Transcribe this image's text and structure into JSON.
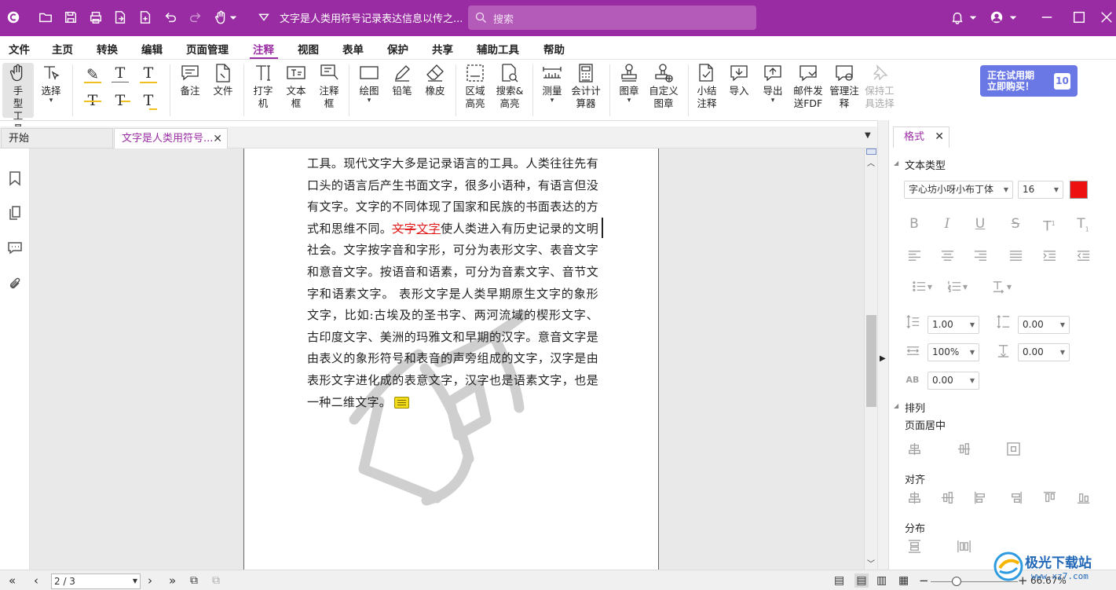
{
  "titlebar": {
    "doc_title": "文字是人类用符号记录表达信息以传之...",
    "search_placeholder": "搜索"
  },
  "menu": [
    "文件",
    "主页",
    "转换",
    "编辑",
    "页面管理",
    "注释",
    "视图",
    "表单",
    "保护",
    "共享",
    "辅助工具",
    "帮助"
  ],
  "menu_active": "注释",
  "ribbon": {
    "hand": "手型工具",
    "select": "选择",
    "note": "备注",
    "file": "文件",
    "typewriter": "打字机",
    "textbox": "文本框",
    "callout": "注释框",
    "draw": "绘图",
    "pencil": "铅笔",
    "eraser": "橡皮",
    "area_highlight": "区域高亮",
    "search_highlight": "搜索&高亮",
    "measure": "测量",
    "calculator": "会计计算器",
    "stamp": "图章",
    "custom_stamp": "自定义图章",
    "summary": "小结注释",
    "import": "导入",
    "export": "导出",
    "email_fdf": "邮件发送FDF",
    "manage": "管理注释",
    "keep_tool": "保持工具选择",
    "promo_line1": "正在试用期",
    "promo_line2": "立即购买！",
    "promo_days": "10"
  },
  "tabs": {
    "start": "开始",
    "doc": "文字是人类用符号..."
  },
  "page_text": {
    "before": "工具。现代文字大多是记录语言的工具。人类往往先有口头的语言后产生书面文字，很多小语种，有语言但没有文字。文字的不同体现了国家和民族的书面表达的方式和思维不同。",
    "struck": "文字",
    "underlined": "文字",
    "after": "使人类进入有历史记录的文明社会。文字按字音和字形，可分为表形文字、表音文字和意音文字。按语音和语素，可分为音素文字、音节文字和语素文字。 表形文字是人类早期原生文字的象形文字，比如:古埃及的圣书字、两河流域的楔形文字、古印度文字、美洲的玛雅文和早期的汉字。意音文字是由表义的象形符号和表音的声旁组成的文字，汉字是由表形文字进化成的表意文字，汉字也是语素文字，也是一种二维文字。"
  },
  "format_panel": {
    "tab": "格式",
    "text_type": "文本类型",
    "font": "字心坊小呀小布丁体",
    "size": "16",
    "color": "#ee1111",
    "line_spacing": "1.00",
    "para_spacing": "0.00",
    "scale": "100%",
    "char_spacing": "0.00",
    "baseline": "0.00",
    "arrange": "排列",
    "page_center": "页面居中",
    "align": "对齐",
    "distribute": "分布"
  },
  "status": {
    "page": "2 / 3",
    "zoom": "66.67%"
  },
  "brand": {
    "name": "极光下载站",
    "url": "www.xz7.com"
  }
}
